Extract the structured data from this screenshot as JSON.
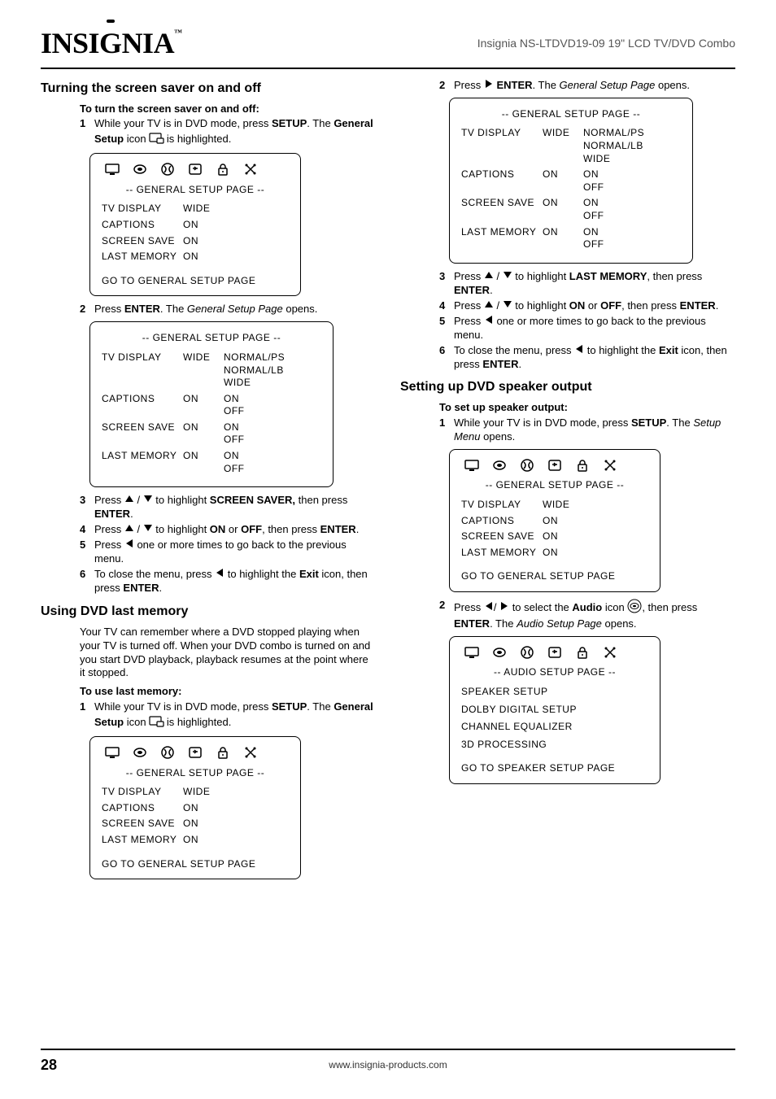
{
  "header": {
    "brand": "INSIGNIA",
    "device": "Insignia NS-LTDVD19-09 19\" LCD TV/DVD Combo"
  },
  "left": {
    "h_screen_saver": "Turning the screen saver on and off",
    "sub_screen_saver": "To turn the screen saver on and off:",
    "s1_a": "While your TV is in DVD mode, press ",
    "s1_b": "SETUP",
    "s1_c": ". The ",
    "s1_d": "General Setup",
    "s1_e": " icon ",
    "s1_f": " is highlighted.",
    "osd1": {
      "title": "--  GENERAL SETUP PAGE --",
      "rows": [
        {
          "c1": "TV DISPLAY",
          "c2": "WIDE"
        },
        {
          "c1": "CAPTIONS",
          "c2": "ON"
        },
        {
          "c1": "SCREEN SAVE",
          "c2": "ON"
        },
        {
          "c1": "LAST MEMORY",
          "c2": "ON"
        }
      ],
      "footer": "GO TO GENERAL SETUP PAGE"
    },
    "s2_a": "Press ",
    "s2_b": "ENTER",
    "s2_c": ". The ",
    "s2_d": "General Setup Page",
    "s2_e": " opens.",
    "osd2": {
      "title": "--  GENERAL SETUP PAGE --",
      "rows": [
        {
          "c1": "TV DISPLAY",
          "c2": "WIDE",
          "c3": [
            "NORMAL/PS",
            "NORMAL/LB",
            "WIDE"
          ]
        },
        {
          "c1": "CAPTIONS",
          "c2": "ON",
          "c3": [
            "ON",
            "OFF"
          ]
        },
        {
          "c1": "SCREEN SAVE",
          "c2": "ON",
          "c3": [
            "ON",
            "OFF"
          ]
        },
        {
          "c1": "LAST MEMORY",
          "c2": "ON",
          "c3": [
            "ON",
            "OFF"
          ]
        }
      ]
    },
    "s3_a": "Press ",
    "s3_b": " to highlight ",
    "s3_c": "SCREEN SAVER,",
    "s3_d": " then press ",
    "s3_e": "ENTER",
    "s3_f": ".",
    "s4_a": "Press ",
    "s4_b": " to highlight ",
    "s4_c": "ON",
    "s4_d": " or ",
    "s4_e": "OFF",
    "s4_f": ", then press ",
    "s4_g": "ENTER",
    "s4_h": ".",
    "s5_a": "Press ",
    "s5_b": " one or more times to go back to the previous menu.",
    "s6_a": "To close the menu, press ",
    "s6_b": " to highlight the ",
    "s6_c": "Exit",
    "s6_d": " icon, then press ",
    "s6_e": "ENTER",
    "s6_f": ".",
    "h_last_mem": "Using DVD last memory",
    "intro_last_mem": "Your TV can remember where a DVD stopped playing when your TV is turned off. When your DVD combo is turned on and you start DVD playback, playback resumes at the point where it stopped.",
    "sub_last_mem": "To use last memory:",
    "lm1_a": "While your TV is in DVD mode, press ",
    "lm1_b": "SETUP",
    "lm1_c": ". The ",
    "lm1_d": "General Setup",
    "lm1_e": " icon ",
    "lm1_f": "is highlighted.",
    "osd3": {
      "title": "--  GENERAL SETUP PAGE --",
      "rows": [
        {
          "c1": "TV DISPLAY",
          "c2": "WIDE"
        },
        {
          "c1": "CAPTIONS",
          "c2": "ON"
        },
        {
          "c1": "SCREEN SAVE",
          "c2": "ON"
        },
        {
          "c1": "LAST MEMORY",
          "c2": "ON"
        }
      ],
      "footer": "GO TO GENERAL SETUP PAGE"
    }
  },
  "right": {
    "r2_a": "Press ",
    "r2_b": "ENTER",
    "r2_c": ". The ",
    "r2_d": "General Setup Page",
    "r2_e": " opens.",
    "osd4": {
      "title": "--  GENERAL SETUP PAGE --",
      "rows": [
        {
          "c1": "TV DISPLAY",
          "c2": "WIDE",
          "c3": [
            "NORMAL/PS",
            "NORMAL/LB",
            "WIDE"
          ]
        },
        {
          "c1": "CAPTIONS",
          "c2": "ON",
          "c3": [
            "ON",
            "OFF"
          ]
        },
        {
          "c1": "SCREEN SAVE",
          "c2": "ON",
          "c3": [
            "ON",
            "OFF"
          ]
        },
        {
          "c1": "LAST MEMORY",
          "c2": "ON",
          "c3": [
            "ON",
            "OFF"
          ]
        }
      ]
    },
    "r3_a": "Press ",
    "r3_b": " to highlight ",
    "r3_c": "LAST MEMORY",
    "r3_d": ", then press ",
    "r3_e": "ENTER",
    "r3_f": ".",
    "r4_a": "Press ",
    "r4_b": " to highlight ",
    "r4_c": "ON",
    "r4_d": " or ",
    "r4_e": "OFF",
    "r4_f": ", then press ",
    "r4_g": "ENTER",
    "r4_h": ".",
    "r5_a": "Press ",
    "r5_b": " one or more times to go back to the previous menu.",
    "r6_a": "To close the menu, press ",
    "r6_b": " to highlight the ",
    "r6_c": "Exit",
    "r6_d": " icon, then press ",
    "r6_e": "ENTER",
    "r6_f": ".",
    "h_speaker": "Setting up DVD speaker output",
    "sub_speaker": "To set up speaker output:",
    "sp1_a": "While your TV is in DVD mode, press ",
    "sp1_b": "SETUP",
    "sp1_c": ". The ",
    "sp1_d": "Setup Menu",
    "sp1_e": " opens.",
    "osd5": {
      "title": "--  GENERAL SETUP PAGE --",
      "rows": [
        {
          "c1": "TV DISPLAY",
          "c2": "WIDE"
        },
        {
          "c1": "CAPTIONS",
          "c2": "ON"
        },
        {
          "c1": "SCREEN SAVE",
          "c2": "ON"
        },
        {
          "c1": "LAST MEMORY",
          "c2": "ON"
        }
      ],
      "footer": "GO TO GENERAL SETUP PAGE"
    },
    "sp2_a": "Press ",
    "sp2_b": " to select the ",
    "sp2_c": "Audio",
    "sp2_d": " icon ",
    "sp2_e": ", then press ",
    "sp2_f": "ENTER",
    "sp2_g": ". The ",
    "sp2_h": "Audio Setup Page",
    "sp2_i": " opens.",
    "osd6": {
      "title": "-- AUDIO SETUP PAGE --",
      "list": [
        "SPEAKER SETUP",
        "DOLBY DIGITAL SETUP",
        "CHANNEL EQUALIZER",
        "3D PROCESSING"
      ],
      "footer": "GO TO SPEAKER SETUP PAGE"
    }
  },
  "footer": {
    "page": "28",
    "url": "www.insignia-products.com"
  }
}
